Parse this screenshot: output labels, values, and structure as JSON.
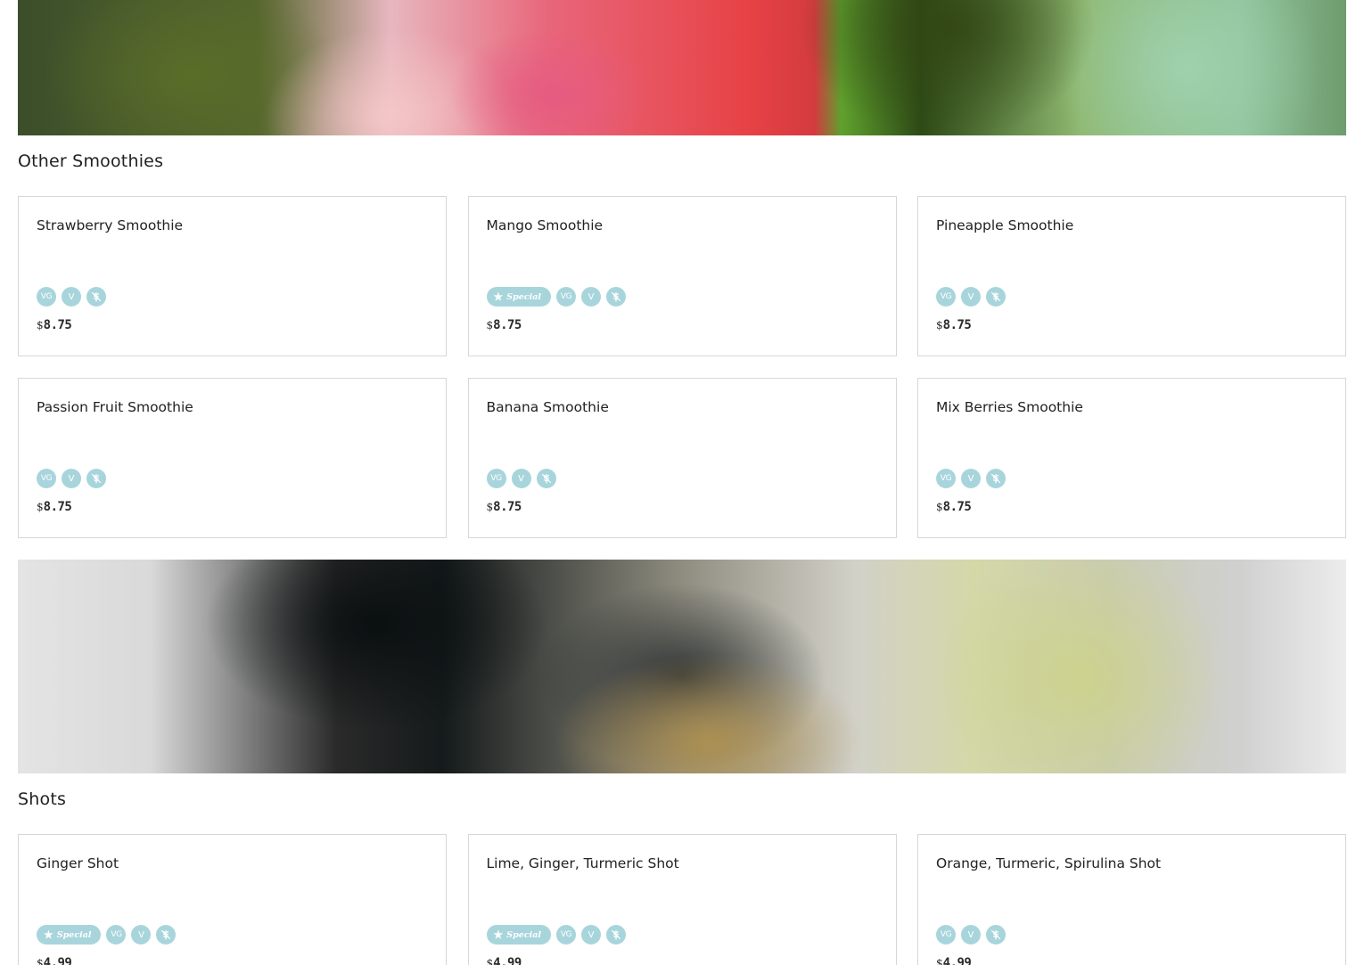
{
  "colors": {
    "badge_bg": "#a8d5dc",
    "card_border": "#d7d7d7",
    "text": "#222222"
  },
  "badge_labels": {
    "vegan": "VG",
    "vegetarian": "V",
    "gluten_free_icon": "wheat-slash-icon",
    "special": "Special"
  },
  "sections": [
    {
      "title": "Other Smoothies",
      "items": [
        {
          "name": "Strawberry Smoothie",
          "special": false,
          "currency": "$",
          "price": "8.75"
        },
        {
          "name": "Mango Smoothie",
          "special": true,
          "currency": "$",
          "price": "8.75"
        },
        {
          "name": "Pineapple Smoothie",
          "special": false,
          "currency": "$",
          "price": "8.75"
        },
        {
          "name": "Passion Fruit Smoothie",
          "special": false,
          "currency": "$",
          "price": "8.75"
        },
        {
          "name": "Banana Smoothie",
          "special": false,
          "currency": "$",
          "price": "8.75"
        },
        {
          "name": "Mix Berries Smoothie",
          "special": false,
          "currency": "$",
          "price": "8.75"
        }
      ]
    },
    {
      "title": "Shots",
      "items": [
        {
          "name": "Ginger Shot",
          "special": true,
          "currency": "$",
          "price": "4.99"
        },
        {
          "name": "Lime, Ginger, Turmeric Shot",
          "special": true,
          "currency": "$",
          "price": "4.99"
        },
        {
          "name": "Orange, Turmeric, Spirulina Shot",
          "special": false,
          "currency": "$",
          "price": "4.99"
        }
      ]
    }
  ]
}
